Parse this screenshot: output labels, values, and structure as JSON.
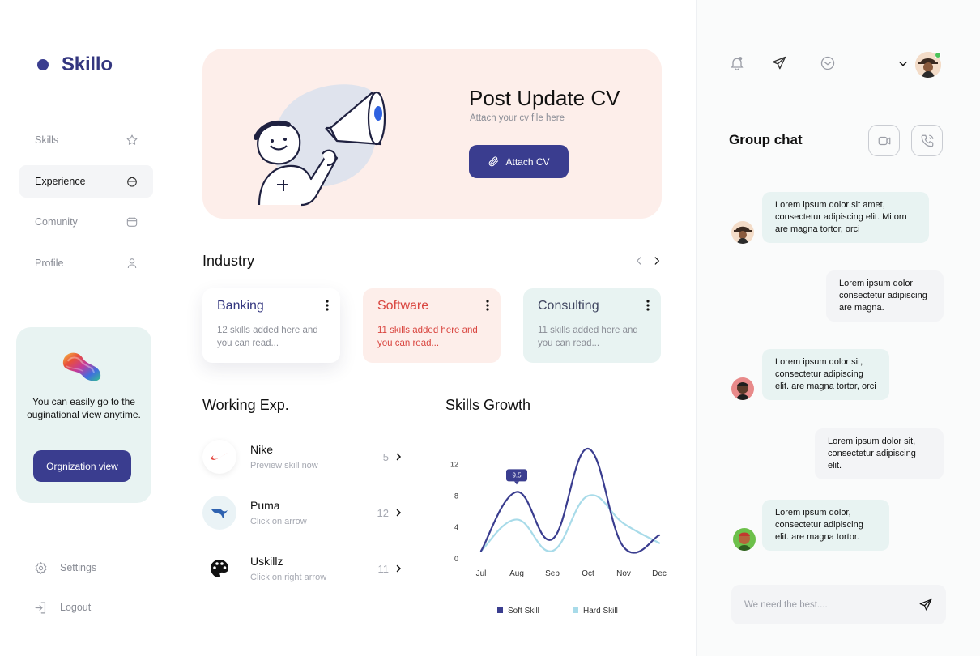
{
  "app": {
    "name": "Skillo"
  },
  "sidebar": {
    "items": [
      {
        "label": "Skills",
        "icon": "star-icon",
        "active": false
      },
      {
        "label": "Experience",
        "icon": "briefcase-icon",
        "active": true
      },
      {
        "label": "Comunity",
        "icon": "calendar-icon",
        "active": false
      },
      {
        "label": "Profile",
        "icon": "user-icon",
        "active": false
      }
    ],
    "org_card": {
      "text": "You can easily go to the ouginational view anytime.",
      "button": "Orgnization view"
    },
    "bottom": [
      {
        "label": "Settings",
        "icon": "gear-icon"
      },
      {
        "label": "Logout",
        "icon": "logout-icon"
      }
    ]
  },
  "hero": {
    "title": "Post Update CV",
    "subtitle": "Attach your cv file here",
    "button": "Attach CV"
  },
  "industry": {
    "title": "Industry",
    "cards": [
      {
        "name": "Banking",
        "desc": "12 skills added here and you can read..."
      },
      {
        "name": "Software",
        "desc": "11 skills added here and you can read..."
      },
      {
        "name": "Consulting",
        "desc": "11 skills added here and you can read..."
      }
    ]
  },
  "work": {
    "title": "Working Exp.",
    "items": [
      {
        "name": "Nike",
        "sub": "Preview skill now",
        "count": "5"
      },
      {
        "name": "Puma",
        "sub": "Click on arrow",
        "count": "12"
      },
      {
        "name": "Uskillz",
        "sub": "Click on right arrow",
        "count": "11"
      }
    ]
  },
  "skills": {
    "title": "Skills Growth"
  },
  "chart_data": {
    "type": "line",
    "title": "Skills Growth",
    "categories": [
      "Jul",
      "Aug",
      "Sep",
      "Oct",
      "Nov",
      "Dec"
    ],
    "yticks": [
      "0",
      "4",
      "8",
      "12"
    ],
    "ylim": [
      0,
      14
    ],
    "series": [
      {
        "name": "Soft Skill",
        "color": "#3a3d8f",
        "values": [
          1,
          8.5,
          2.5,
          14,
          1.5,
          3
        ]
      },
      {
        "name": "Hard Skill",
        "color": "#a8dbe9",
        "values": [
          1,
          5,
          1,
          8,
          4.5,
          2
        ]
      }
    ],
    "annotation": {
      "label": "9.5",
      "category": "Aug"
    },
    "legend": "bottom"
  },
  "colors": {
    "accent": "#3a3d8f",
    "peach": "#fdeeea",
    "mint": "#e8f3f2",
    "red": "#d9453f"
  },
  "chat": {
    "title": "Group chat",
    "messages": [
      {
        "side": "in",
        "text": "Lorem ipsum dolor sit amet, consectetur adipiscing elit. Mi orn are magna tortor, orci"
      },
      {
        "side": "out",
        "text": "Lorem ipsum dolor consectetur adipiscing are magna."
      },
      {
        "side": "in",
        "text": "Lorem ipsum dolor sit, consectetur adipiscing elit. are magna tortor, orci"
      },
      {
        "side": "out",
        "text": "Lorem ipsum dolor sit, consectetur adipiscing elit."
      },
      {
        "side": "in",
        "text": "Lorem ipsum dolor, consectetur adipiscing elit. are magna tortor."
      }
    ],
    "input_placeholder": "We need the best...."
  }
}
